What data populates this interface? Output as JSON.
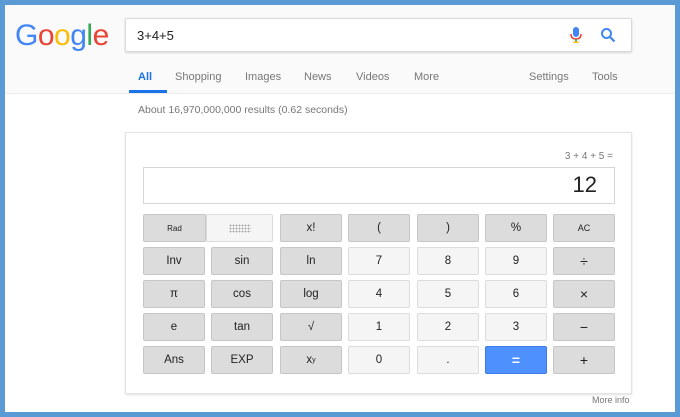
{
  "logo": {
    "letters": [
      "G",
      "o",
      "o",
      "g",
      "l",
      "e"
    ],
    "colors": [
      "#4285f4",
      "#ea4335",
      "#fbbc05",
      "#4285f4",
      "#34a853",
      "#ea4335"
    ]
  },
  "search": {
    "value": "3+4+5"
  },
  "tabs": [
    "All",
    "Shopping",
    "Images",
    "News",
    "Videos",
    "More",
    "Settings",
    "Tools"
  ],
  "results_text": "About 16,970,000,000 results (0.62 seconds)",
  "calculator": {
    "expression": "3 + 4 + 5 =",
    "display_value": "12",
    "buttons": {
      "rad": "Rad",
      "factorial": "x!",
      "lparen": "(",
      "rparen": ")",
      "percent": "%",
      "ac": "AC",
      "inv": "Inv",
      "sin": "sin",
      "ln": "ln",
      "seven": "7",
      "eight": "8",
      "nine": "9",
      "divide": "÷",
      "pi": "π",
      "cos": "cos",
      "log": "log",
      "four": "4",
      "five": "5",
      "six": "6",
      "multiply": "×",
      "e": "e",
      "tan": "tan",
      "sqrt": "√",
      "one": "1",
      "two": "2",
      "three": "3",
      "minus": "−",
      "ans": "Ans",
      "exp": "EXP",
      "power_base": "x",
      "power_exp": "y",
      "zero": "0",
      "dot": ".",
      "equals": "=",
      "plus": "+"
    }
  },
  "more_info": "More info",
  "colors": {
    "accent": "#1a73e8",
    "equals": "#4d90fe",
    "frame": "#5b9bd5"
  }
}
